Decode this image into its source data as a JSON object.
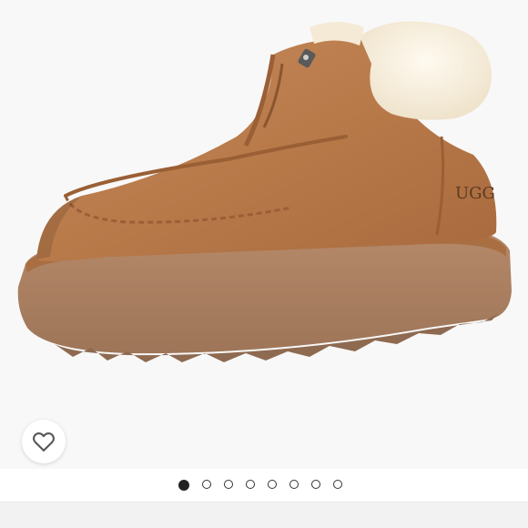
{
  "product": {
    "image_description_icon": "product-photo",
    "brand_mark": "UGG"
  },
  "like": {
    "icon": "heart-outline-icon",
    "color": "#555555"
  },
  "carousel": {
    "total_images": 8,
    "active_index": 0,
    "active_color": "#222222",
    "inactive_border": "#333333"
  }
}
